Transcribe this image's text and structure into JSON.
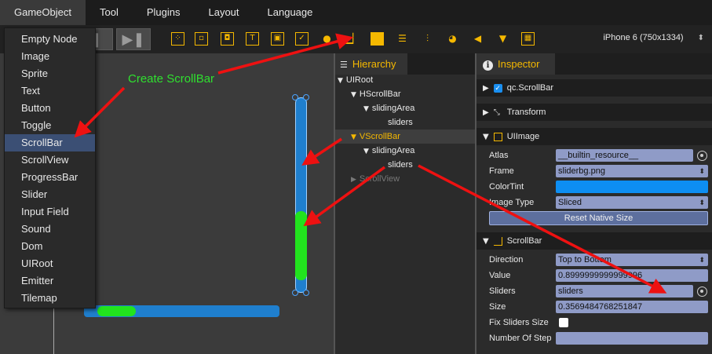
{
  "menu": [
    "GameObject",
    "Tool",
    "Plugins",
    "Layout",
    "Language"
  ],
  "toolbar": {
    "device": "iPhone 6 (750x1334)",
    "play_icon": "play-icon",
    "step_icon": "step-forward-icon",
    "widget_icons": [
      "node-icon",
      "image-icon",
      "sprite-icon",
      "text-icon",
      "button-icon",
      "toggle-icon",
      "scrollbar-icon",
      "scrollview-icon",
      "progressbar-icon",
      "slider-icon",
      "input-field-icon",
      "sound-icon",
      "dom-icon",
      "emitter-icon",
      "tilemap-icon"
    ]
  },
  "dropdown": {
    "items": [
      "Empty Node",
      "Image",
      "Sprite",
      "Text",
      "Button",
      "Toggle",
      "ScrollBar",
      "ScrollView",
      "ProgressBar",
      "Slider",
      "Input Field",
      "Sound",
      "Dom",
      "UIRoot",
      "Emitter",
      "Tilemap"
    ],
    "selected": "ScrollBar"
  },
  "annotation": "Create ScrollBar",
  "scene": {
    "vertical_scrollbar": {
      "track_color": "#1f7fce",
      "thumb_color": "#22e31e"
    },
    "horizontal_scrollbar": {
      "track_color": "#1f7fce",
      "thumb_color": "#22e31e"
    }
  },
  "hierarchy": {
    "title": "Hierarchy",
    "items": [
      {
        "label": "UIRoot",
        "expanded": true
      },
      {
        "label": "HScrollBar",
        "expanded": true
      },
      {
        "label": "slidingArea",
        "expanded": true
      },
      {
        "label": "sliders"
      },
      {
        "label": "VScrollBar",
        "expanded": true,
        "selected": true
      },
      {
        "label": "slidingArea",
        "expanded": true
      },
      {
        "label": "sliders"
      },
      {
        "label": "ScrollView",
        "expanded": false
      }
    ]
  },
  "inspector": {
    "title": "Inspector",
    "sections": {
      "scrollbar_component": "qc.ScrollBar",
      "transform": "Transform",
      "uiimage": "UIImage",
      "scrollbar": "ScrollBar"
    },
    "uiimage": {
      "atlas_label": "Atlas",
      "atlas_value": "__builtin_resource__",
      "frame_label": "Frame",
      "frame_value": "sliderbg.png",
      "colortint_label": "ColorTint",
      "colortint_value": "#0d8ef2",
      "imagetype_label": "Image Type",
      "imagetype_value": "Sliced",
      "reset_button": "Reset Native Size"
    },
    "scrollbar": {
      "direction_label": "Direction",
      "direction_value": "Top to Bottom",
      "value_label": "Value",
      "value_value": "0.8999999999999996",
      "sliders_label": "Sliders",
      "sliders_value": "sliders",
      "size_label": "Size",
      "size_value": "0.3569484768251847",
      "fix_label": "Fix Sliders Size",
      "fix_checked": false,
      "steps_label": "Number Of Step",
      "steps_value": ""
    }
  },
  "colors": {
    "accent": "#f5b800",
    "annotation": "#2fe02f",
    "arrow": "#ee1111",
    "selection": "#3b4f74"
  }
}
